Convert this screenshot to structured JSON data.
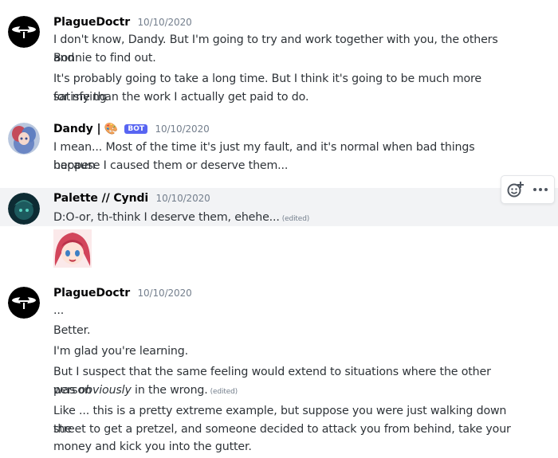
{
  "messages": [
    {
      "author": "PlagueDoctr",
      "timestamp": "10/10/2020",
      "lines": [
        "I don't know, Dandy. But I'm going to try and work together with you, the others and",
        "Bonnie to find out.",
        "It's probably going to take a long time. But I think it's going to be much more satisfying",
        "for me than the work I actually get paid to do."
      ]
    },
    {
      "author": "Dandy |",
      "emoji": "🎨",
      "bot_tag": "BOT",
      "timestamp": "10/10/2020",
      "lines": [
        "I mean... Most of the time it's just my fault, and it's normal when bad things happen",
        "because I caused them or deserve them..."
      ]
    },
    {
      "author": "Palette // Cyndi",
      "timestamp": "10/10/2020",
      "lines": [
        "D:O-or, th-think I deserve them, ehehe..."
      ],
      "edited": "(edited)"
    },
    {
      "author": "PlagueDoctr",
      "timestamp": "10/10/2020",
      "lines": [
        "...",
        "Better.",
        "I'm glad you're learning.",
        "But I suspect that the same feeling would extend to situations where the other person",
        "was ",
        "obviously",
        " in the wrong.",
        "Like ... this is a pretty extreme example, but suppose you were just walking down the",
        "street to get a pretzel, and someone decided to attack you from behind, take your",
        "money and kick you into the gutter."
      ],
      "edited": "(edited)"
    }
  ],
  "toolbar": {
    "icons": [
      "add-reaction-icon",
      "more-options-icon"
    ]
  }
}
